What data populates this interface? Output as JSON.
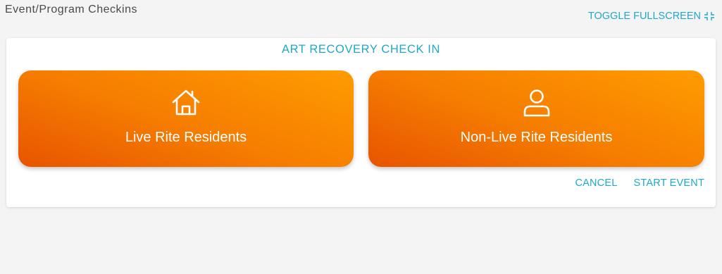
{
  "page": {
    "title": "Event/Program Checkins"
  },
  "header": {
    "toggle_fullscreen_label": "TOGGLE FULLSCREEN",
    "toggle_fullscreen_icon": "fullscreen-exit-icon"
  },
  "card": {
    "title": "ART RECOVERY CHECK IN",
    "options": [
      {
        "label": "Live Rite Residents",
        "icon": "home-icon"
      },
      {
        "label": "Non-Live Rite Residents",
        "icon": "person-icon"
      }
    ],
    "actions": {
      "cancel_label": "CANCEL",
      "start_label": "START EVENT"
    }
  },
  "colors": {
    "accent": "#1fa8c9",
    "button_gradient_start": "#e85400",
    "button_gradient_end": "#ff9c00",
    "page_background": "#f4f4f4"
  }
}
